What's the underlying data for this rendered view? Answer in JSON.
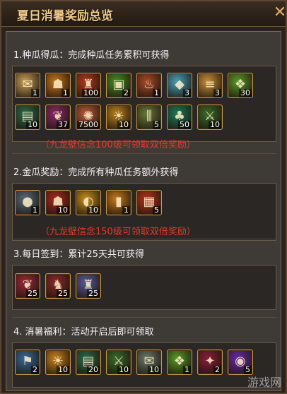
{
  "window": {
    "title": "夏日消暑奖励总览",
    "close_glyph": "✕"
  },
  "sections": [
    {
      "title": "1.种瓜得瓜：完成种瓜任务累积可获得",
      "rows": [
        [
          {
            "icon": "scroll-icon",
            "glyph": "✉",
            "qty": "1",
            "color": "#c9a058"
          },
          {
            "icon": "helmet-icon",
            "glyph": "☗",
            "qty": "1",
            "color": "#c8741e"
          },
          {
            "icon": "armor-icon",
            "glyph": "♜",
            "qty": "100",
            "color": "#b23a1e"
          },
          {
            "icon": "gift-box-icon",
            "glyph": "▣",
            "qty": "2",
            "color": "#4a8a2a"
          },
          {
            "icon": "pouch-icon",
            "glyph": "♨",
            "qty": "1",
            "color": "#a84a2a"
          },
          {
            "icon": "crystal-icon",
            "glyph": "◆",
            "qty": "3",
            "color": "#4aa0b8"
          },
          {
            "icon": "scroll-bundle-icon",
            "glyph": "≡",
            "qty": "3",
            "color": "#c8903a"
          },
          {
            "icon": "gift-pack-icon",
            "glyph": "❖",
            "qty": "30",
            "color": "#5a9a2a"
          }
        ],
        [
          {
            "icon": "manual-book-icon",
            "glyph": "▤",
            "qty": "10",
            "color": "#2a6a4a"
          },
          {
            "icon": "feather-helm-icon",
            "glyph": "❦",
            "qty": "37",
            "color": "#8a2a6a"
          },
          {
            "icon": "swirl-orb-icon",
            "glyph": "✺",
            "qty": "7500",
            "color": "#b85a3a"
          },
          {
            "icon": "golden-helm-icon",
            "glyph": "☀",
            "qty": "10",
            "color": "#b8821e"
          },
          {
            "icon": "bamboo-scroll-icon",
            "glyph": "⫼",
            "qty": "5",
            "color": "#6a7a3a"
          },
          {
            "icon": "jade-leaf-icon",
            "glyph": "♣",
            "qty": "50",
            "color": "#1e7a5a"
          },
          {
            "icon": "spear-icon",
            "glyph": "⚔",
            "qty": "10",
            "color": "#3a6a2a"
          }
        ]
      ],
      "note": "（九龙壁信念100级可领取双倍奖励）"
    },
    {
      "title": "2.金瓜奖励：完成所有种瓜任务额外获得",
      "rows": [
        [
          {
            "icon": "pearl-icon",
            "glyph": "●",
            "qty": "1",
            "color": "#5a6a7a"
          },
          {
            "icon": "red-helm-icon",
            "glyph": "☗",
            "qty": "10",
            "color": "#a82a1e"
          },
          {
            "icon": "gold-coin-icon",
            "glyph": "◐",
            "qty": "10",
            "color": "#c8901e"
          },
          {
            "icon": "token-card-icon",
            "glyph": "▮",
            "qty": "1",
            "color": "#c87a1e"
          },
          {
            "icon": "chest-icon",
            "glyph": "▦",
            "qty": "5",
            "color": "#b8341e"
          }
        ]
      ],
      "note": "（九龙壁信念150级可领取双倍奖励）"
    },
    {
      "title": "3.每日签到：累计25天共可获得",
      "rows": [
        [
          {
            "icon": "crest-helm-icon",
            "glyph": "❦",
            "qty": "25",
            "color": "#9a2a3a"
          },
          {
            "icon": "horse-head-icon",
            "glyph": "♞",
            "qty": "25",
            "color": "#8a2a2a"
          },
          {
            "icon": "silver-armor-icon",
            "glyph": "♜",
            "qty": "25",
            "color": "#5a5a9a"
          }
        ]
      ],
      "note": ""
    },
    {
      "title": "4. 消暑福利：活动开启后即可领取",
      "rows": [
        [
          {
            "icon": "war-banner-icon",
            "glyph": "⚑",
            "qty": "2",
            "color": "#3a6a9a"
          },
          {
            "icon": "sun-orb-icon",
            "glyph": "☀",
            "qty": "10",
            "color": "#c8821e"
          },
          {
            "icon": "manual-book-icon",
            "glyph": "▤",
            "qty": "20",
            "color": "#2a6a4a"
          },
          {
            "icon": "spear-icon",
            "glyph": "⚔",
            "qty": "10",
            "color": "#3a6a2a"
          },
          {
            "icon": "silver-scroll-icon",
            "glyph": "✉",
            "qty": "10",
            "color": "#6a7a6a"
          },
          {
            "icon": "gift-pack-icon",
            "glyph": "❖",
            "qty": "1",
            "color": "#5a9a2a"
          },
          {
            "icon": "rune-icon",
            "glyph": "✦",
            "qty": "2",
            "color": "#8a1e3a"
          },
          {
            "icon": "amethyst-orb-icon",
            "glyph": "◉",
            "qty": "5",
            "color": "#6a2aa8"
          }
        ]
      ],
      "note": ""
    }
  ],
  "watermark": "游戏网"
}
